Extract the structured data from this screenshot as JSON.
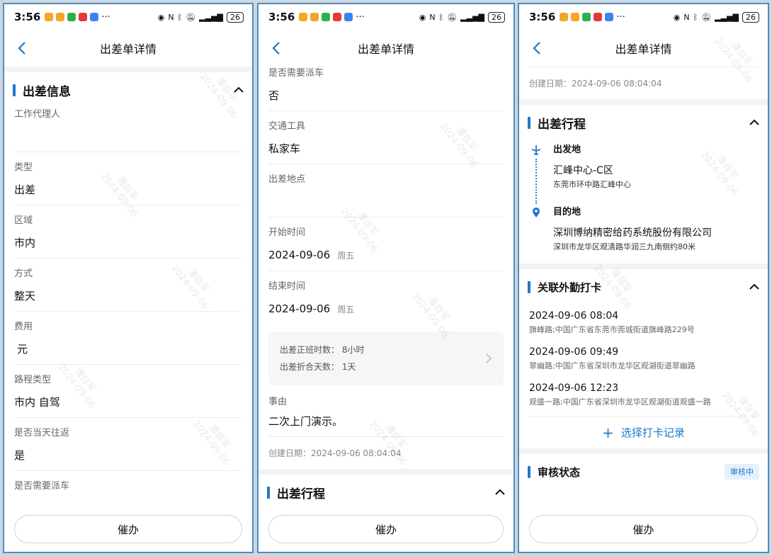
{
  "status": {
    "time": "3:56",
    "battery": "26",
    "dots": "···"
  },
  "nav": {
    "title": "出差单详情"
  },
  "watermark": {
    "name": "潘自军",
    "date": "2024-09-06"
  },
  "colors": {
    "accent": "#1e78c8",
    "frame": "#4a8ec4"
  },
  "icons": {
    "back": "chevron-left-icon",
    "collapse": "chevron-up-icon",
    "more": "chevron-right-icon",
    "departure": "plane-icon",
    "destination": "location-pin-icon"
  },
  "screen1": {
    "section_title": "出差信息",
    "fields": [
      {
        "label": "工作代理人",
        "value": ""
      },
      {
        "label": "类型",
        "value": "出差"
      },
      {
        "label": "区域",
        "value": "市内"
      },
      {
        "label": "方式",
        "value": "整天"
      },
      {
        "label": "费用",
        "value": "元"
      },
      {
        "label": "路程类型",
        "value": "市内 自驾"
      },
      {
        "label": "是否当天往返",
        "value": "是"
      },
      {
        "label": "是否需要派车",
        "value": ""
      }
    ]
  },
  "screen2": {
    "fields": [
      {
        "label": "是否需要派车",
        "value": "否"
      },
      {
        "label": "交通工具",
        "value": "私家车"
      },
      {
        "label": "出差地点",
        "value": ""
      }
    ],
    "start": {
      "label": "开始时间",
      "date": "2024-09-06",
      "weekday": "周五"
    },
    "end": {
      "label": "结束时间",
      "date": "2024-09-06",
      "weekday": "周五"
    },
    "summary": {
      "hours": "出差正班时数：  8小时",
      "days": "出差折合天数：  1天"
    },
    "reason": {
      "label": "事由",
      "value": "二次上门演示。"
    },
    "created": "创建日期：2024-09-06 08:04:04",
    "next_section": "出差行程"
  },
  "screen3": {
    "created": "创建日期：2024-09-06 08:04:04",
    "itinerary_title": "出差行程",
    "departure": {
      "tag": "出发地",
      "place": "汇峰中心-C区",
      "address": "东莞市环中路汇峰中心"
    },
    "destination": {
      "tag": "目的地",
      "place": "深圳博纳精密给药系统股份有限公司",
      "address": "深圳市龙华区观清路华润三九南侧约80米"
    },
    "checkin_title": "关联外勤打卡",
    "checkins": [
      {
        "time": "2024-09-06 08:04",
        "address": "旗峰路;中国广东省东莞市莞城街道旗峰路229号"
      },
      {
        "time": "2024-09-06 09:49",
        "address": "翠幽路;中国广东省深圳市龙华区观湖街道翠幽路"
      },
      {
        "time": "2024-09-06 12:23",
        "address": "观盛一路;中国广东省深圳市龙华区观湖街道观盛一路"
      }
    ],
    "choose_label": "选择打卡记录",
    "audit_title": "审核状态",
    "audit_badge": "审核中"
  },
  "bottom": {
    "urge_label": "催办"
  }
}
